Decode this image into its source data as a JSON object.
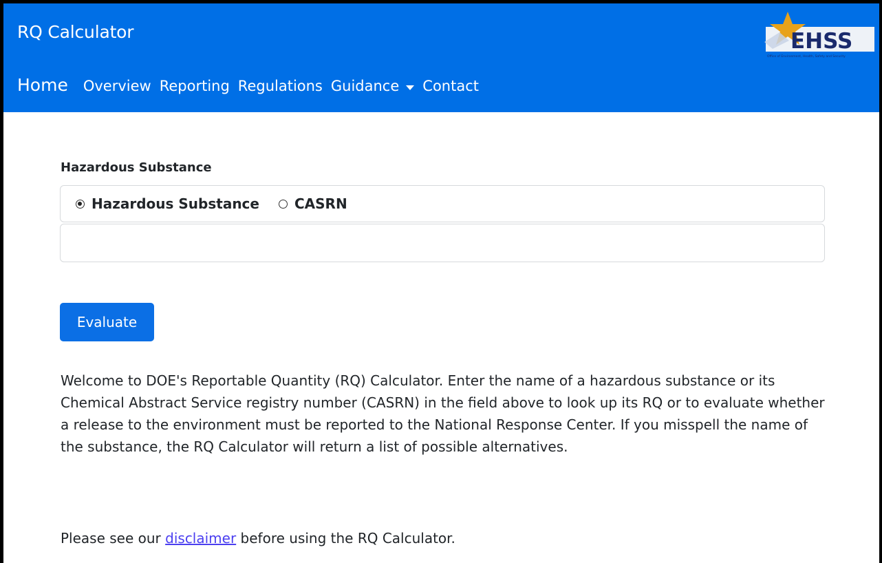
{
  "header": {
    "app_title": "RQ Calculator",
    "logo_text": "EHSS",
    "logo_subtext": "Office of Environment, Health, Safety and Security"
  },
  "nav": {
    "home": "Home",
    "items": [
      {
        "label": "Overview"
      },
      {
        "label": "Reporting"
      },
      {
        "label": "Regulations"
      },
      {
        "label": "Guidance",
        "has_dropdown": true
      },
      {
        "label": "Contact"
      }
    ]
  },
  "form": {
    "section_label": "Hazardous Substance",
    "radio_options": [
      {
        "label": "Hazardous Substance",
        "checked": true
      },
      {
        "label": "CASRN",
        "checked": false
      }
    ],
    "input_value": "",
    "evaluate_label": "Evaluate"
  },
  "content": {
    "welcome_text": "Welcome to DOE's Reportable Quantity (RQ) Calculator. Enter the name of a hazardous substance or its Chemical Abstract Service registry number (CASRN) in the field above to look up its RQ or to evaluate whether a release to the environment must be reported to the National Response Center. If you misspell the name of the substance, the RQ Calculator will return a list of possible alternatives.",
    "disclaimer_prefix": "Please see our ",
    "disclaimer_link": "disclaimer",
    "disclaimer_suffix": " before using the RQ Calculator."
  },
  "colors": {
    "header_blue": "#006fe6",
    "button_blue": "#0b6fe5",
    "link_color": "#4b3ff0",
    "logo_gold": "#e8a21a",
    "logo_navy": "#1a2a6c"
  }
}
